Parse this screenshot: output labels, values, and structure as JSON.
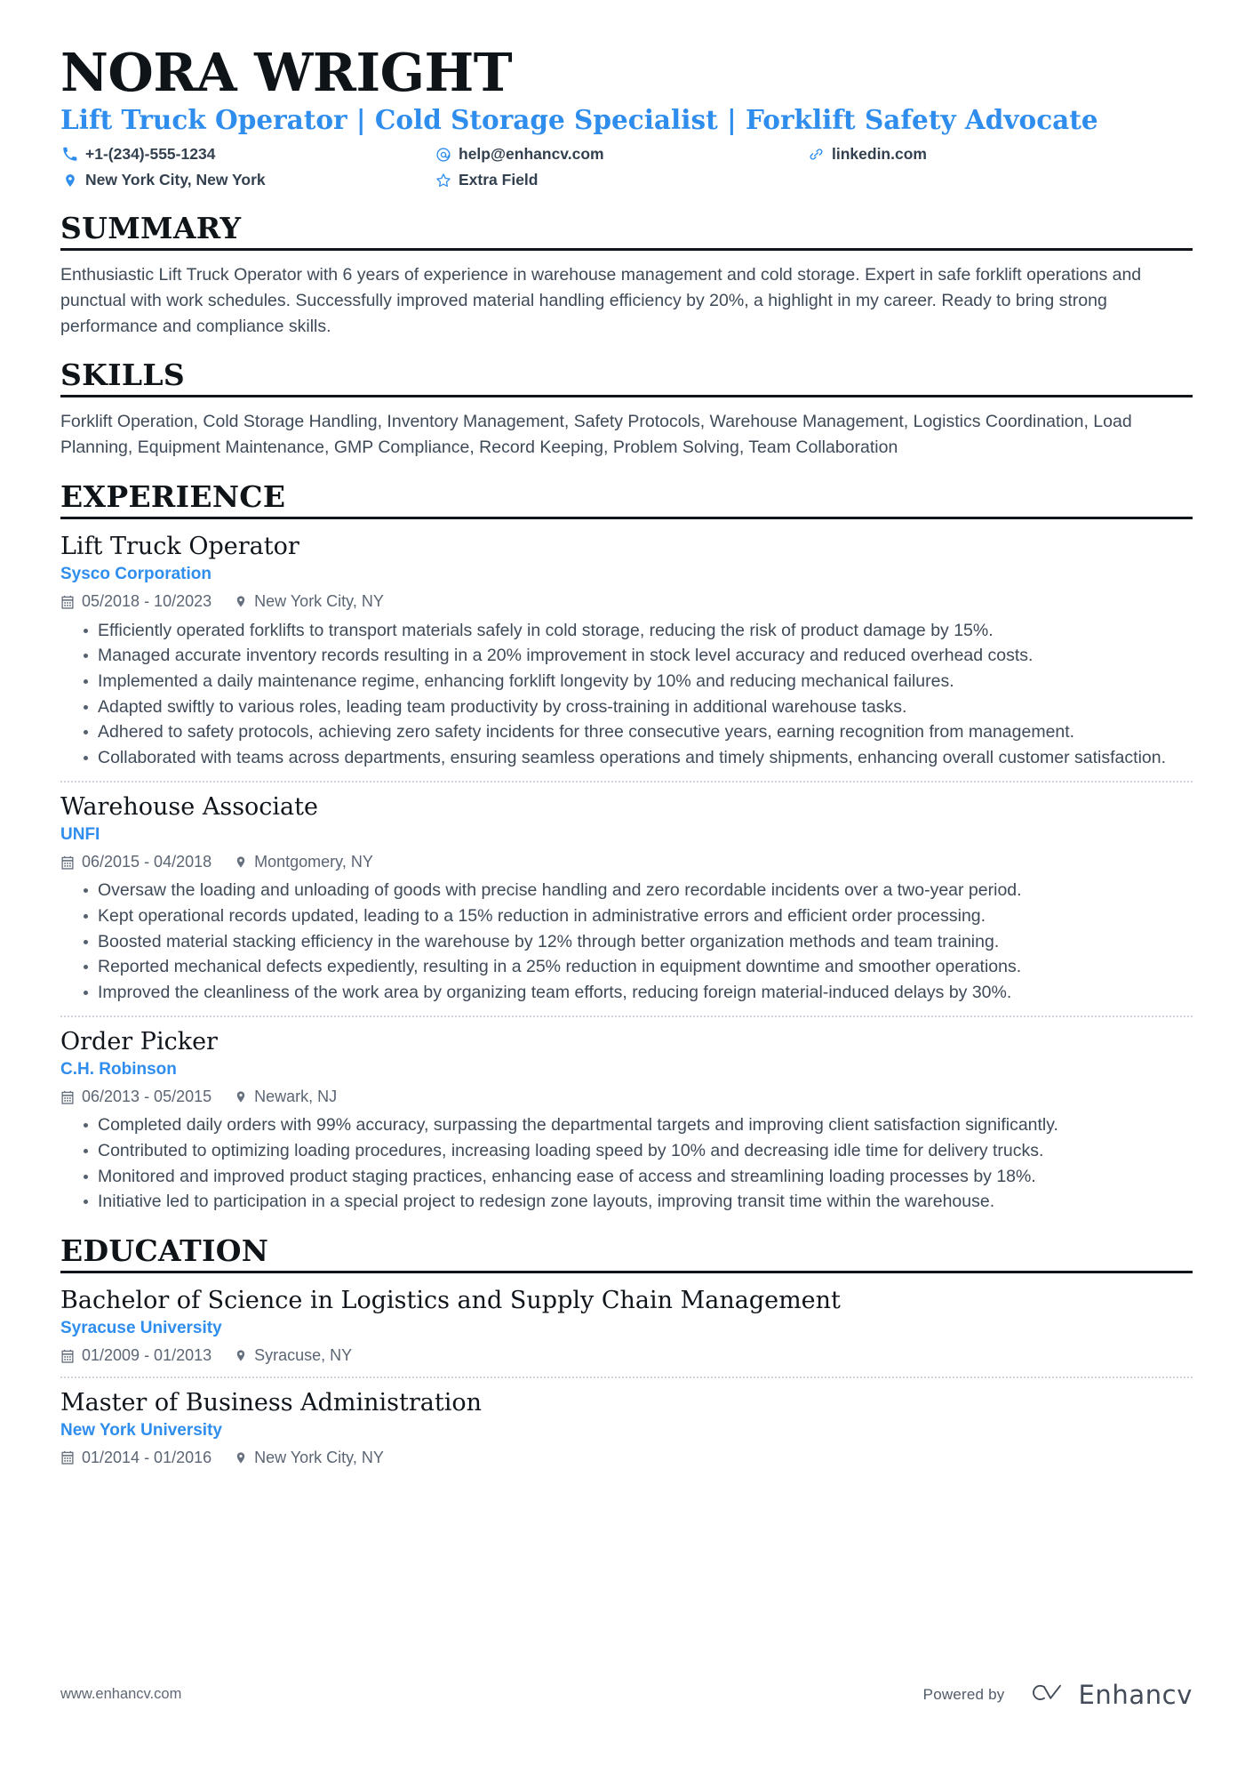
{
  "header": {
    "name": "NORA WRIGHT",
    "headline": "Lift Truck Operator | Cold Storage Specialist | Forklift Safety Advocate",
    "accent_color": "#2f8ded",
    "contacts": [
      {
        "icon": "phone-icon",
        "value": "+1-(234)-555-1234"
      },
      {
        "icon": "email-icon",
        "value": "help@enhancv.com"
      },
      {
        "icon": "link-icon",
        "value": "linkedin.com"
      },
      {
        "icon": "location-icon",
        "value": "New York City, New York"
      },
      {
        "icon": "star-icon",
        "value": "Extra Field"
      }
    ]
  },
  "sections": {
    "summary": {
      "title": "SUMMARY",
      "text": "Enthusiastic Lift Truck Operator with 6 years of experience in warehouse management and cold storage. Expert in safe forklift operations and punctual with work schedules. Successfully improved material handling efficiency by 20%, a highlight in my career. Ready to bring strong performance and compliance skills."
    },
    "skills": {
      "title": "SKILLS",
      "text": "Forklift Operation, Cold Storage Handling, Inventory Management, Safety Protocols, Warehouse Management, Logistics Coordination, Load Planning, Equipment Maintenance, GMP Compliance, Record Keeping, Problem Solving, Team Collaboration"
    },
    "experience": {
      "title": "EXPERIENCE",
      "entries": [
        {
          "title": "Lift Truck Operator",
          "org": "Sysco Corporation",
          "dates": "05/2018 - 10/2023",
          "location": "New York City, NY",
          "bullets": [
            "Efficiently operated forklifts to transport materials safely in cold storage, reducing the risk of product damage by 15%.",
            "Managed accurate inventory records resulting in a 20% improvement in stock level accuracy and reduced overhead costs.",
            "Implemented a daily maintenance regime, enhancing forklift longevity by 10% and reducing mechanical failures.",
            "Adapted swiftly to various roles, leading team productivity by cross-training in additional warehouse tasks.",
            "Adhered to safety protocols, achieving zero safety incidents for three consecutive years, earning recognition from management.",
            "Collaborated with teams across departments, ensuring seamless operations and timely shipments, enhancing overall customer satisfaction."
          ]
        },
        {
          "title": "Warehouse Associate",
          "org": "UNFI",
          "dates": "06/2015 - 04/2018",
          "location": "Montgomery, NY",
          "bullets": [
            "Oversaw the loading and unloading of goods with precise handling and zero recordable incidents over a two-year period.",
            "Kept operational records updated, leading to a 15% reduction in administrative errors and efficient order processing.",
            "Boosted material stacking efficiency in the warehouse by 12% through better organization methods and team training.",
            "Reported mechanical defects expediently, resulting in a 25% reduction in equipment downtime and smoother operations.",
            "Improved the cleanliness of the work area by organizing team efforts, reducing foreign material-induced delays by 30%."
          ]
        },
        {
          "title": "Order Picker",
          "org": "C.H. Robinson",
          "dates": "06/2013 - 05/2015",
          "location": "Newark, NJ",
          "bullets": [
            "Completed daily orders with 99% accuracy, surpassing the departmental targets and improving client satisfaction significantly.",
            "Contributed to optimizing loading procedures, increasing loading speed by 10% and decreasing idle time for delivery trucks.",
            "Monitored and improved product staging practices, enhancing ease of access and streamlining loading processes by 18%.",
            "Initiative led to participation in a special project to redesign zone layouts, improving transit time within the warehouse."
          ]
        }
      ]
    },
    "education": {
      "title": "EDUCATION",
      "entries": [
        {
          "title": "Bachelor of Science in Logistics and Supply Chain Management",
          "org": "Syracuse University",
          "dates": "01/2009 - 01/2013",
          "location": "Syracuse, NY"
        },
        {
          "title": "Master of Business Administration",
          "org": "New York University",
          "dates": "01/2014 - 01/2016",
          "location": "New York City, NY"
        }
      ]
    }
  },
  "footer": {
    "url": "www.enhancv.com",
    "powered_by": "Powered by",
    "brand": "Enhancv"
  }
}
